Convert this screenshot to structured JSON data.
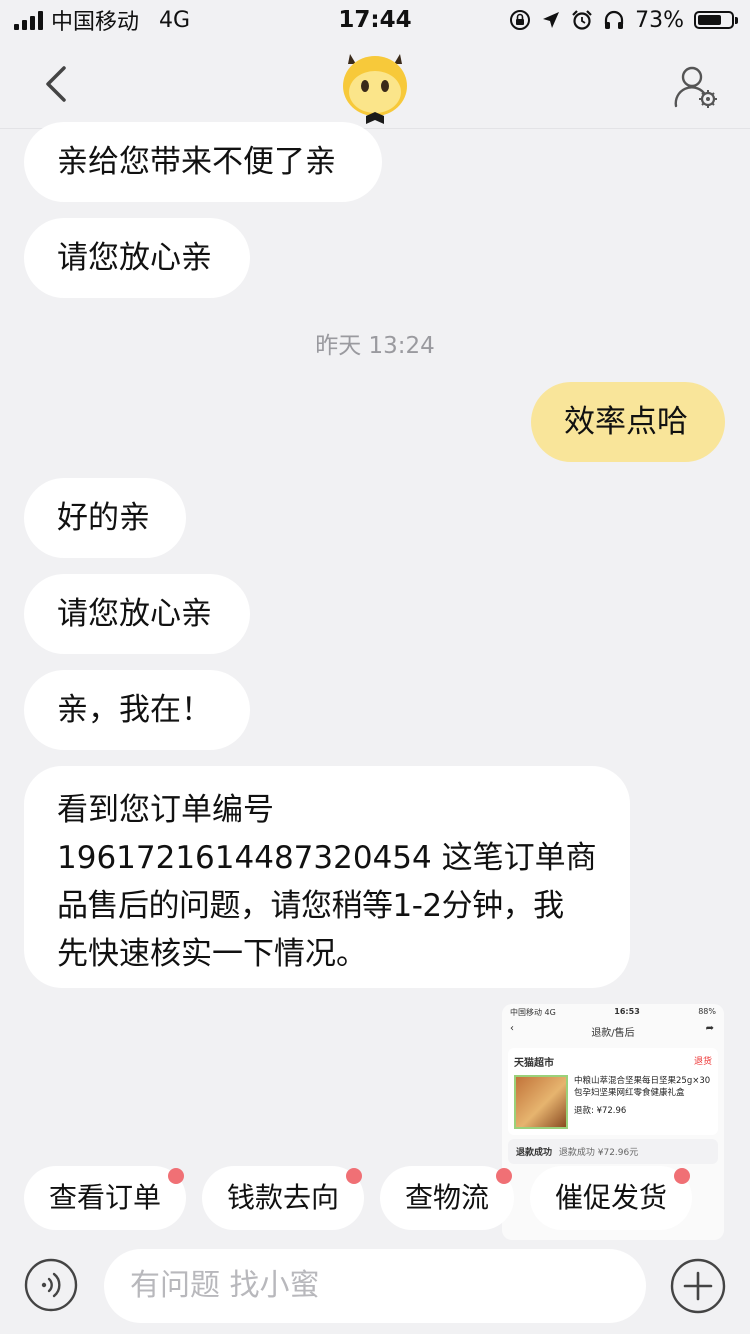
{
  "status_bar": {
    "carrier": "中国移动",
    "network": "4G",
    "time": "17:44",
    "battery_text": "73%",
    "battery_level": 0.73
  },
  "nav": {
    "back_icon": "chevron-left-icon",
    "mascot_icon": "mascot-avatar-icon",
    "settings_icon": "user-settings-icon"
  },
  "messages": [
    {
      "side": "left",
      "text": "亲给您带来不便了亲"
    },
    {
      "side": "left",
      "text": "请您放心亲"
    },
    {
      "side": "right",
      "text": "效率点哈"
    },
    {
      "side": "left",
      "text": "好的亲"
    },
    {
      "side": "left",
      "text": "请您放心亲"
    },
    {
      "side": "left",
      "text": "亲，我在！"
    },
    {
      "side": "left",
      "lines": [
        "看到您订单编号",
        "1961721614487320454 这笔订单商",
        "品售后的问题，请您稍等1-2分钟，我",
        "先快速核实一下情况。"
      ]
    }
  ],
  "timestamp": "昨天 13:24",
  "screenshot_thumb": {
    "carrier": "中国移动 4G",
    "time": "16:53",
    "battery": "88%",
    "title": "退款/售后",
    "shop": "天猫超市",
    "return_tag": "退货",
    "product_name": "中粮山萃混合坚果每日坚果25g×30包孕妇坚果网红零食健康礼盒",
    "refund_label": "退款: ¥72.96",
    "status": "退款成功",
    "status_detail": "退款成功 ¥72.96元"
  },
  "quick_replies": [
    {
      "label": "查看订单"
    },
    {
      "label": "钱款去向"
    },
    {
      "label": "查物流"
    },
    {
      "label": "催促发货"
    }
  ],
  "input": {
    "placeholder": "有问题 找小蜜",
    "voice_icon": "voice-icon",
    "plus_icon": "plus-icon"
  },
  "colors": {
    "background": "#f1f1f3",
    "my_bubble": "#f9e59a",
    "other_bubble": "#ffffff",
    "badge_dot": "#f07075"
  }
}
